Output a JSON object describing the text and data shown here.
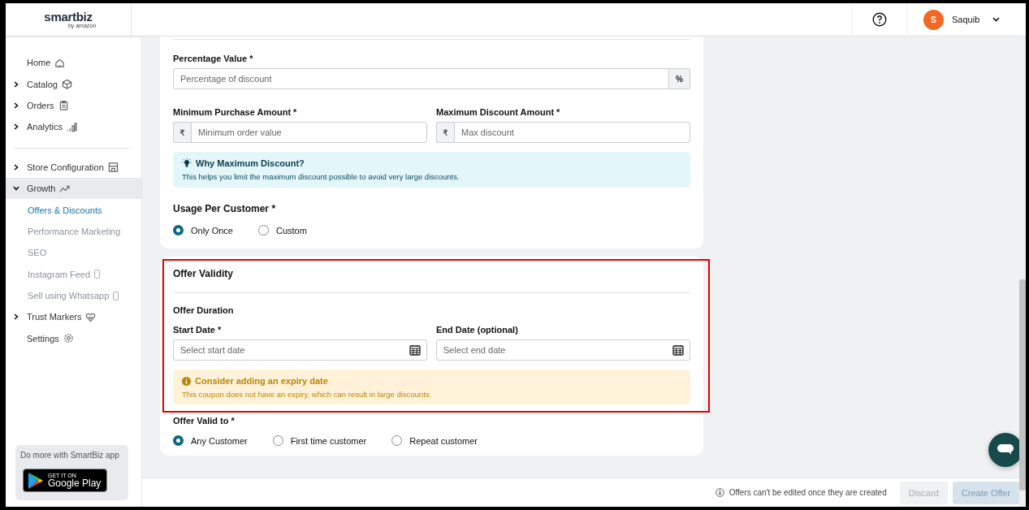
{
  "header": {
    "logo": "smartbiz",
    "logo_sub": "by amazon",
    "user": {
      "initial": "S",
      "name": "Saquib"
    }
  },
  "sidebar": {
    "items": [
      {
        "label": "Home",
        "kind": "link",
        "expanded": false,
        "selected": false
      },
      {
        "label": "Catalog",
        "kind": "group",
        "expanded": false,
        "selected": false
      },
      {
        "label": "Orders",
        "kind": "group",
        "expanded": false,
        "selected": false
      },
      {
        "label": "Analytics",
        "kind": "group",
        "expanded": false,
        "selected": false
      },
      {
        "label": "Store Configuration",
        "kind": "group",
        "expanded": false,
        "selected": false
      },
      {
        "label": "Growth",
        "kind": "group",
        "expanded": true,
        "selected": false,
        "children": [
          {
            "label": "Offers & Discounts",
            "selected": true
          },
          {
            "label": "Performance Marketing",
            "selected": false
          },
          {
            "label": "SEO",
            "selected": false
          },
          {
            "label": "Instagram Feed",
            "selected": false
          },
          {
            "label": "Sell using Whatsapp",
            "selected": false
          }
        ]
      },
      {
        "label": "Trust Markers",
        "kind": "group",
        "expanded": false,
        "selected": false
      },
      {
        "label": "Settings",
        "kind": "link",
        "expanded": false,
        "selected": false
      }
    ],
    "promo": {
      "text": "Do more with SmartBiz app",
      "badge_small": "GET IT ON",
      "badge_large": "Google Play"
    }
  },
  "discount_card": {
    "percentage": {
      "label": "Percentage Value *",
      "placeholder": "Percentage of discount",
      "suffix": "%"
    },
    "min_purchase": {
      "label": "Minimum Purchase Amount *",
      "prefix": "₹",
      "placeholder": "Minimum order value"
    },
    "max_discount": {
      "label": "Maximum Discount Amount *",
      "prefix": "₹",
      "placeholder": "Max discount"
    },
    "info": {
      "title": "Why Maximum Discount?",
      "text": "This helps you limit the maximum discount possible to avoid very large discounts."
    },
    "usage": {
      "label": "Usage Per Customer *",
      "options": [
        {
          "label": "Only Once",
          "selected": true
        },
        {
          "label": "Custom",
          "selected": false
        }
      ]
    }
  },
  "validity_card": {
    "highlighted": true,
    "title": "Offer Validity",
    "duration_title": "Offer Duration",
    "start_date": {
      "label": "Start Date *",
      "placeholder": "Select start date"
    },
    "end_date": {
      "label": "End Date (optional)",
      "placeholder": "Select end date"
    },
    "warning": {
      "title": "Consider adding an expiry date",
      "text": "This coupon does not have an expiry, which can result in large discounts."
    },
    "valid_to": {
      "label": "Offer Valid to *",
      "options": [
        {
          "label": "Any Customer",
          "selected": true
        },
        {
          "label": "First time customer",
          "selected": false
        },
        {
          "label": "Repeat customer",
          "selected": false
        }
      ]
    }
  },
  "footer": {
    "note": "Offers can't be edited once they are created",
    "buttons": [
      {
        "label": "Discard",
        "kind": "secondary",
        "disabled": true
      },
      {
        "label": "Create Offer",
        "kind": "primary",
        "disabled": true
      }
    ]
  }
}
